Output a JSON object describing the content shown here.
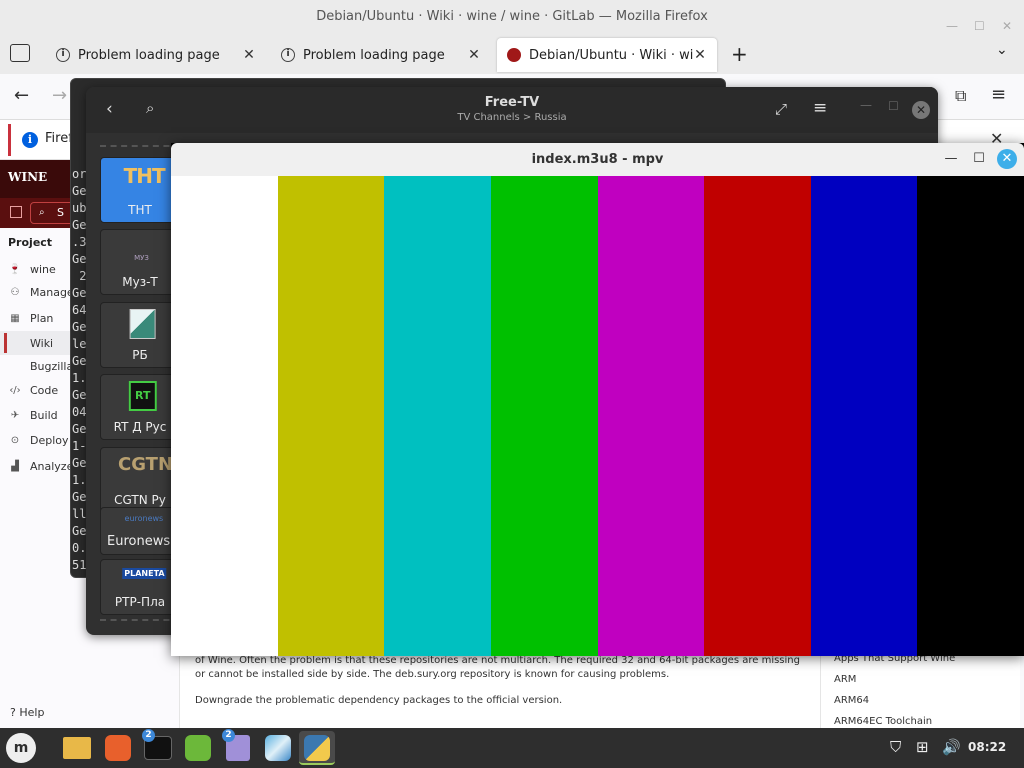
{
  "firefox": {
    "window_title": "Debian/Ubuntu · Wiki · wine / wine · GitLab — Mozilla Firefox",
    "tabs": [
      {
        "label": "Problem loading page"
      },
      {
        "label": "Problem loading page"
      },
      {
        "label": "Debian/Ubuntu · Wiki · wine"
      }
    ],
    "infobar_text": "Firef"
  },
  "gitlab": {
    "logo_text": "WINE",
    "search_text": "S",
    "section_label": "Project",
    "nav": [
      {
        "label": "wine"
      },
      {
        "label": "Manage"
      },
      {
        "label": "Plan"
      },
      {
        "label": "Wiki"
      },
      {
        "label": "Bugzilla"
      },
      {
        "label": "Code"
      },
      {
        "label": "Build"
      },
      {
        "label": "Deploy"
      },
      {
        "label": "Analyze"
      }
    ],
    "help_label": "Help",
    "content": {
      "para1": "of Wine. Often the problem is that these repositories are not multiarch. The required 32 and 64-bit packages are missing or cannot be installed side by side. The deb.sury.org repository is known for causing problems.",
      "para2": "Downgrade the problematic dependency packages to the official version.",
      "right_links": [
        "Apps That Support Wine",
        "ARM",
        "ARM64",
        "ARM64EC Toolchain"
      ]
    }
  },
  "terminal": {
    "lines": [
      "or",
      "Ge",
      "ub",
      "Ge",
      ".3",
      "Ge",
      " 2",
      "Ge",
      "64",
      "Ge",
      "le",
      "Ge",
      "1.",
      "Ge",
      "04",
      "Ge",
      "1-",
      "Ge",
      "1.",
      "Ge",
      "ll",
      "Ge",
      "0.",
      "51"
    ]
  },
  "freetv": {
    "title": "Free-TV",
    "subtitle": "TV Channels > Russia",
    "channels": [
      {
        "label": "ТНТ"
      },
      {
        "label": "Муз-Т"
      },
      {
        "label": "РБ"
      },
      {
        "label": "RT Д Рус"
      },
      {
        "label": "CGTN Ру"
      },
      {
        "label": "Euronews"
      },
      {
        "label": "РТР-Пла"
      }
    ],
    "logo_texts": {
      "tnt": "ТНТ",
      "rt": "RT",
      "cgtn": "CGTN",
      "euronews": "euronews",
      "planeta": "PLANETA",
      "muz": "МУЗ"
    }
  },
  "mpv": {
    "title": "index.m3u8 - mpv",
    "color_bars": [
      "#ffffff",
      "#c0c000",
      "#00c0c0",
      "#00c000",
      "#c000c0",
      "#c00000",
      "#0000c0",
      "#000000"
    ]
  },
  "taskbar": {
    "clock": "08:22",
    "badges": [
      "2",
      "2"
    ]
  }
}
